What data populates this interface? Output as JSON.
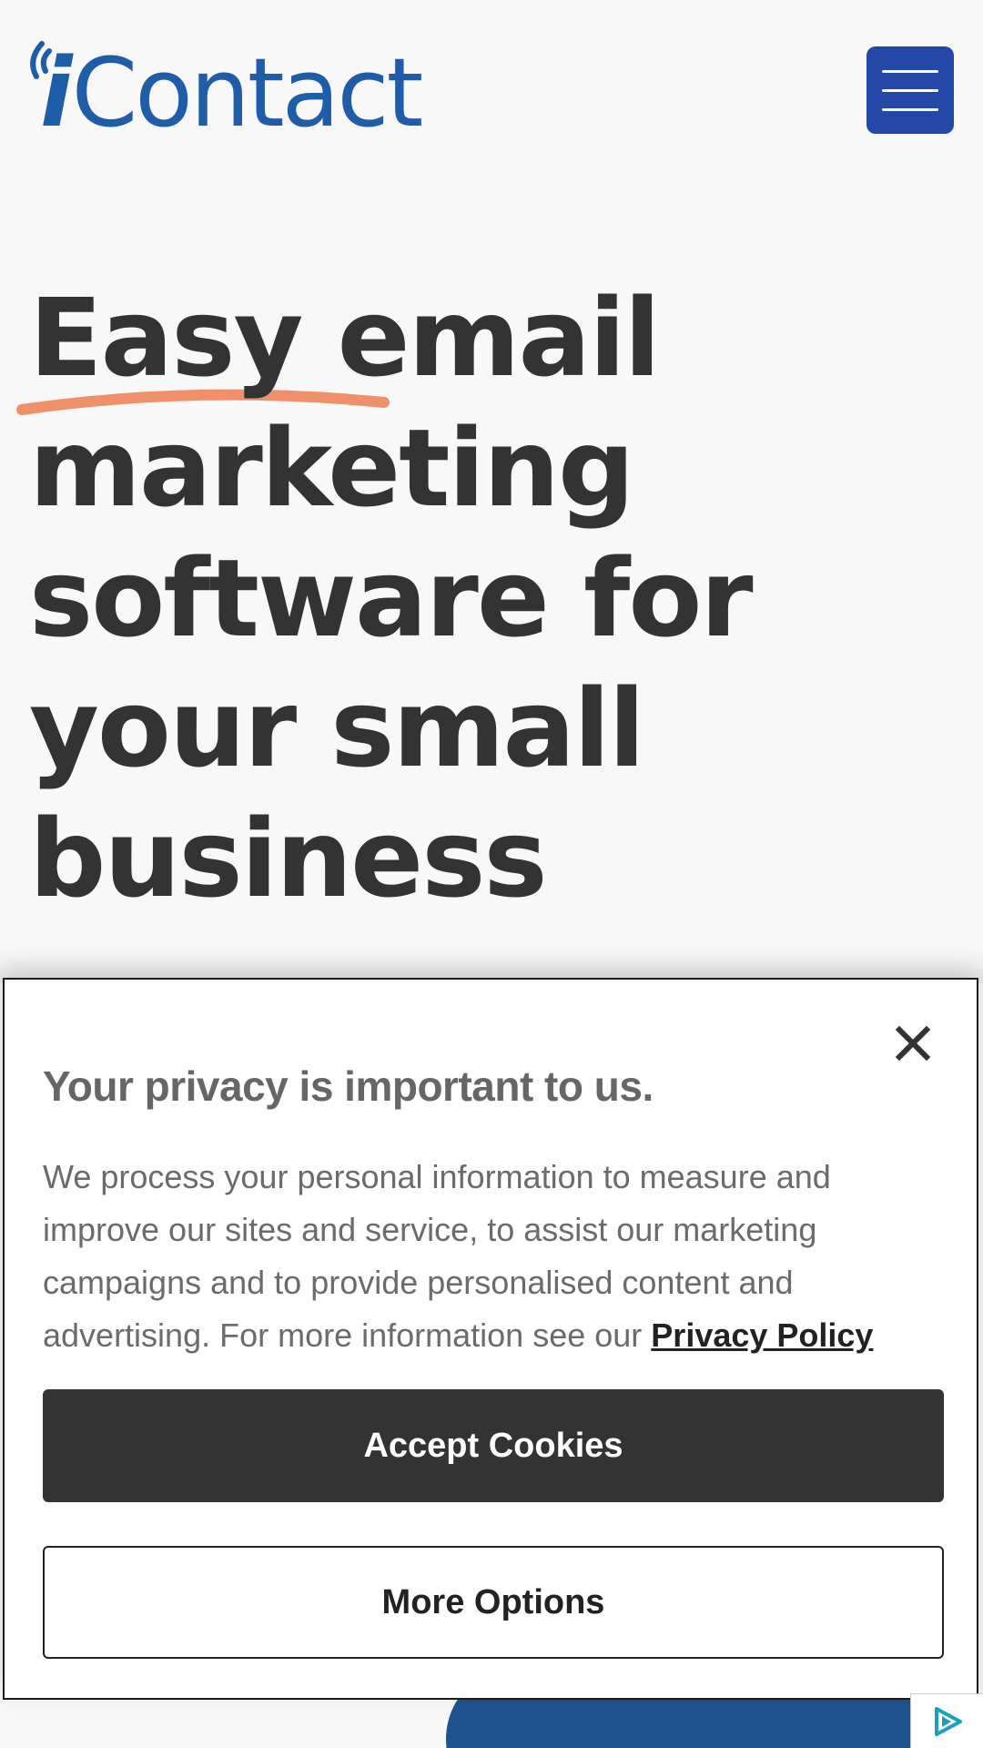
{
  "header": {
    "logo_text": "Contact",
    "logo_prefix": "i",
    "brand_color": "#1f5da8",
    "menu_button_color": "#2447a8",
    "menu_icon": "hamburger-icon"
  },
  "hero": {
    "title_lines": [
      "Easy email",
      "marketing",
      "software for",
      "your small",
      "business"
    ],
    "underline_color": "#f0906a"
  },
  "cookie_banner": {
    "close_icon": "close-icon",
    "title": "Your privacy is important to us.",
    "body": "We process your personal information to measure and improve our sites and service, to assist our marketing campaigns and to provide personalised content and advertising. For more information see our",
    "privacy_link": "Privacy Policy",
    "accept_label": "Accept Cookies",
    "options_label": "More Options"
  },
  "ad_badge": {
    "icon": "adchoices-icon",
    "color": "#1aa0b8"
  }
}
